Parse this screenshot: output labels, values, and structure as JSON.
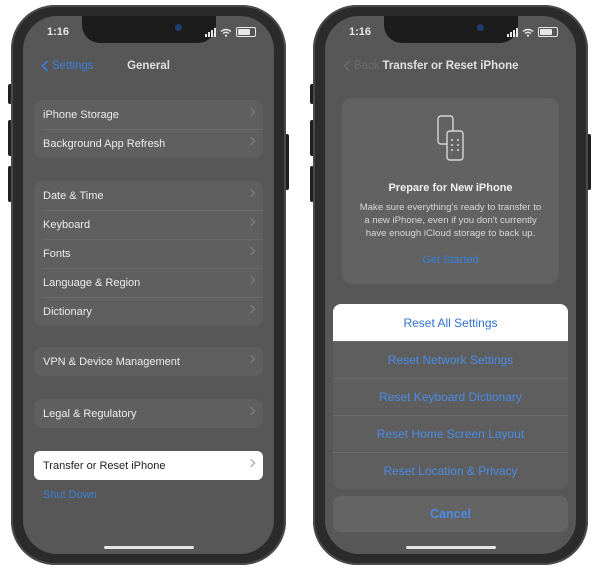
{
  "left": {
    "status": {
      "time": "1:16"
    },
    "nav": {
      "back_label": "Settings",
      "title": "General"
    },
    "groups": [
      [
        "iPhone Storage",
        "Background App Refresh"
      ],
      [
        "Date & Time",
        "Keyboard",
        "Fonts",
        "Language & Region",
        "Dictionary"
      ],
      [
        "VPN & Device Management"
      ],
      [
        "Legal & Regulatory"
      ]
    ],
    "transfer_label": "Transfer or Reset iPhone",
    "shutdown_label": "Shut Down"
  },
  "right": {
    "status": {
      "time": "1:16"
    },
    "nav": {
      "back_label": "Back",
      "title": "Transfer or Reset iPhone"
    },
    "prepare": {
      "title": "Prepare for New iPhone",
      "description": "Make sure everything's ready to transfer to a new iPhone, even if you don't currently have enough iCloud storage to back up.",
      "link": "Get Started"
    },
    "action_sheet": {
      "items": [
        "Reset All Settings",
        "Reset Network Settings",
        "Reset Keyboard Dictionary",
        "Reset Home Screen Layout",
        "Reset Location & Privacy"
      ],
      "highlighted": "Reset All Settings",
      "cancel": "Cancel"
    }
  },
  "colors": {
    "accent": "#3d7fd9",
    "highlight": "#ffffff",
    "phone_frame": "#2b2b2b"
  },
  "icons": [
    "chevron-left-icon",
    "chevron-right-icon",
    "signal-icon",
    "wifi-icon",
    "battery-icon",
    "phone-transfer-icon"
  ]
}
